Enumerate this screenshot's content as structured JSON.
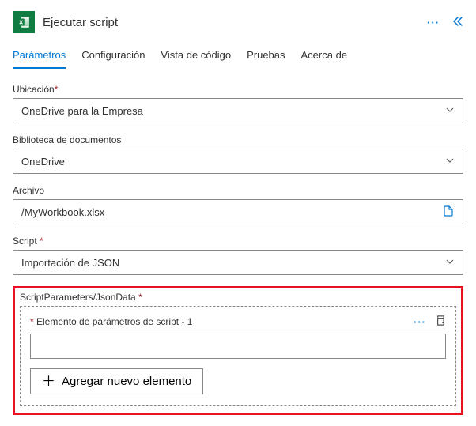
{
  "header": {
    "title": "Ejecutar script"
  },
  "tabs": [
    {
      "label": "Parámetros",
      "active": true
    },
    {
      "label": "Configuración",
      "active": false
    },
    {
      "label": "Vista de código",
      "active": false
    },
    {
      "label": "Pruebas",
      "active": false
    },
    {
      "label": "Acerca de",
      "active": false
    }
  ],
  "fields": {
    "location": {
      "label": "Ubicación",
      "required": true,
      "value": "OneDrive para la Empresa"
    },
    "library": {
      "label": "Biblioteca de documentos",
      "required": false,
      "value": "OneDrive"
    },
    "file": {
      "label": "Archivo",
      "required": false,
      "value": "/MyWorkbook.xlsx"
    },
    "script": {
      "label": "Script",
      "required": true,
      "value": "Importación de JSON"
    }
  },
  "paramSection": {
    "label": "ScriptParameters/JsonData",
    "required": true,
    "item": {
      "label": "Elemento de parámetros de script - 1",
      "required": true,
      "value": ""
    },
    "addLabel": "Agregar nuevo elemento"
  }
}
